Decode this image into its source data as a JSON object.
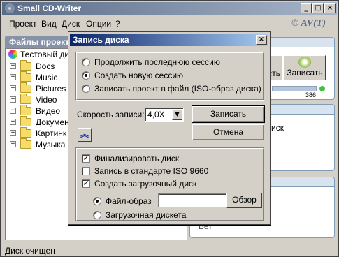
{
  "app": {
    "title": "Small CD-Writer",
    "brand": "© AV(T)",
    "window_buttons": {
      "minimize": "_",
      "maximize": "□",
      "close": "×"
    }
  },
  "menu": [
    "Проект",
    "Вид",
    "Диск",
    "Опции",
    "?"
  ],
  "tree": {
    "header": "Файлы проект",
    "root": "Тестовый ди",
    "items": [
      "Docs",
      "Music",
      "Pictures",
      "Video",
      "Видео",
      "Докумен",
      "Картинк",
      "Музыка"
    ]
  },
  "right": {
    "btn_partial": "сть",
    "burn_label": "Записать",
    "capacity": "386",
    "box_text": "иск",
    "bottom_text": "Бет"
  },
  "status": {
    "text": "Диск очищен"
  },
  "colors": {
    "title_active": "#0a246a",
    "title_inactive": "#5a6b87",
    "face": "#d4d0c8"
  },
  "dialog": {
    "title": "Запись диска",
    "close": "×",
    "session_options": [
      {
        "label": "Продолжить последнюю сессию",
        "selected": false
      },
      {
        "label": "Создать новую сессию",
        "selected": true
      },
      {
        "label": "Записать проект в файл (ISO-образ диска)",
        "selected": false
      }
    ],
    "speed_label": "Скорость записи:",
    "speed_value": "4,0X",
    "burn_button": "Записать",
    "cancel_button": "Отмена",
    "collapse_icon": "chevron-up-icon",
    "checks": [
      {
        "label": "Финализировать диск",
        "checked": true
      },
      {
        "label": "Запись в стандарте ISO 9660",
        "checked": false
      },
      {
        "label": "Создать загрузочный диск",
        "checked": true
      }
    ],
    "boot_options": [
      {
        "label": "Файл-образ",
        "selected": true
      },
      {
        "label": "Загрузочная дискета",
        "selected": false
      }
    ],
    "image_path": "",
    "browse_button": "Обзор"
  }
}
